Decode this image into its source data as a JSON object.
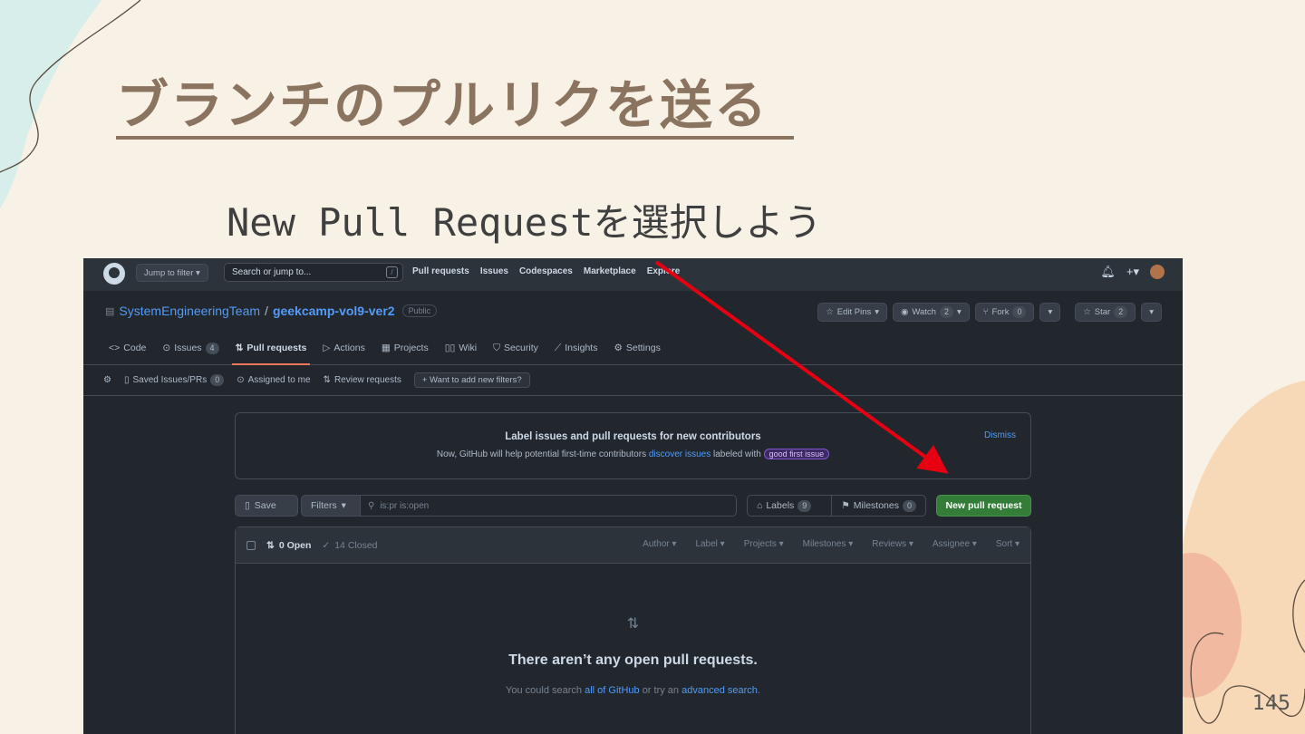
{
  "slide": {
    "title": "ブランチのプルリクを送る",
    "subtitle": "New Pull Requestを選択しよう",
    "page_number": "145"
  },
  "colors": {
    "title": "#8a735f",
    "github_bg": "#22272e",
    "github_header": "#2d333b",
    "link": "#539bf5",
    "primary_button": "#347d39",
    "annotation_arrow": "#e60012"
  },
  "github": {
    "header": {
      "jump_filter": "Jump to filter",
      "search_placeholder": "Search or jump to...",
      "search_key": "/",
      "nav": [
        "Pull requests",
        "Issues",
        "Codespaces",
        "Marketplace",
        "Explore"
      ]
    },
    "repo": {
      "owner": "SystemEngineeringTeam",
      "separator": "/",
      "name": "geekcamp-vol9-ver2",
      "visibility": "Public",
      "actions": {
        "edit_pins": "Edit Pins",
        "watch": "Watch",
        "watch_count": "2",
        "fork": "Fork",
        "fork_count": "0",
        "star": "Star",
        "star_count": "2"
      },
      "tabs": {
        "code": "Code",
        "issues": "Issues",
        "issues_count": "4",
        "pull_requests": "Pull requests",
        "actions": "Actions",
        "projects": "Projects",
        "wiki": "Wiki",
        "security": "Security",
        "insights": "Insights",
        "settings": "Settings"
      }
    },
    "filters": {
      "saved": "Saved Issues/PRs",
      "saved_count": "0",
      "assigned": "Assigned to me",
      "review": "Review requests",
      "want_more": "Want to add new filters?"
    },
    "banner": {
      "title": "Label issues and pull requests for new contributors",
      "text_before": "Now, GitHub will help potential first-time contributors",
      "link": "discover issues",
      "text_after": "labeled with",
      "badge": "good first issue",
      "dismiss": "Dismiss"
    },
    "toolbar": {
      "save": "Save",
      "filters": "Filters",
      "search_value": "is:pr is:open",
      "labels": "Labels",
      "labels_count": "9",
      "milestones": "Milestones",
      "milestones_count": "0",
      "new_pr": "New pull request"
    },
    "list": {
      "open": "0 Open",
      "closed": "14 Closed",
      "sorts": {
        "author": "Author",
        "label": "Label",
        "projects": "Projects",
        "milestones": "Milestones",
        "reviews": "Reviews",
        "assignee": "Assignee",
        "sort": "Sort"
      },
      "empty_title": "There aren’t any open pull requests.",
      "empty_before": "You could search",
      "empty_link1": "all of GitHub",
      "empty_middle": "or try an",
      "empty_link2": "advanced search",
      "empty_end": "."
    }
  }
}
